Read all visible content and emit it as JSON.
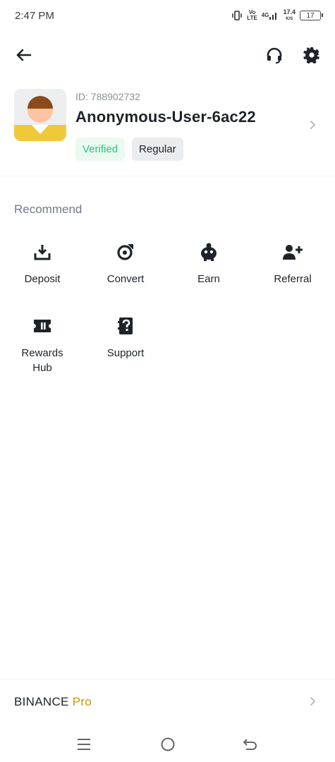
{
  "status_bar": {
    "time": "2:47 PM",
    "network_label_1": "Vo",
    "network_label_2": "LTE",
    "network_type": "4G",
    "speed_value": "17.4",
    "speed_unit": "K/S",
    "battery": "17"
  },
  "header": {
    "back_icon": "arrow-left-icon",
    "support_icon": "headset-icon",
    "settings_icon": "gear-icon"
  },
  "profile": {
    "user_id": "ID: 788902732",
    "username": "Anonymous-User-6ac22",
    "verified_label": "Verified",
    "tier_label": "Regular"
  },
  "recommend": {
    "title": "Recommend",
    "items": [
      {
        "label": "Deposit",
        "icon": "download-icon"
      },
      {
        "label": "Convert",
        "icon": "convert-icon"
      },
      {
        "label": "Earn",
        "icon": "piggy-bank-icon"
      },
      {
        "label": "Referral",
        "icon": "add-user-icon"
      },
      {
        "label": "Rewards\nHub",
        "icon": "ticket-icon"
      },
      {
        "label": "Support",
        "icon": "question-book-icon"
      }
    ]
  },
  "footer": {
    "brand": "BINANCE",
    "suffix": "Pro"
  },
  "colors": {
    "verified_text": "#2ebd85",
    "verified_bg": "#eafaf1",
    "pro_accent": "#c99400",
    "avatar_yellow": "#f0c93a"
  }
}
